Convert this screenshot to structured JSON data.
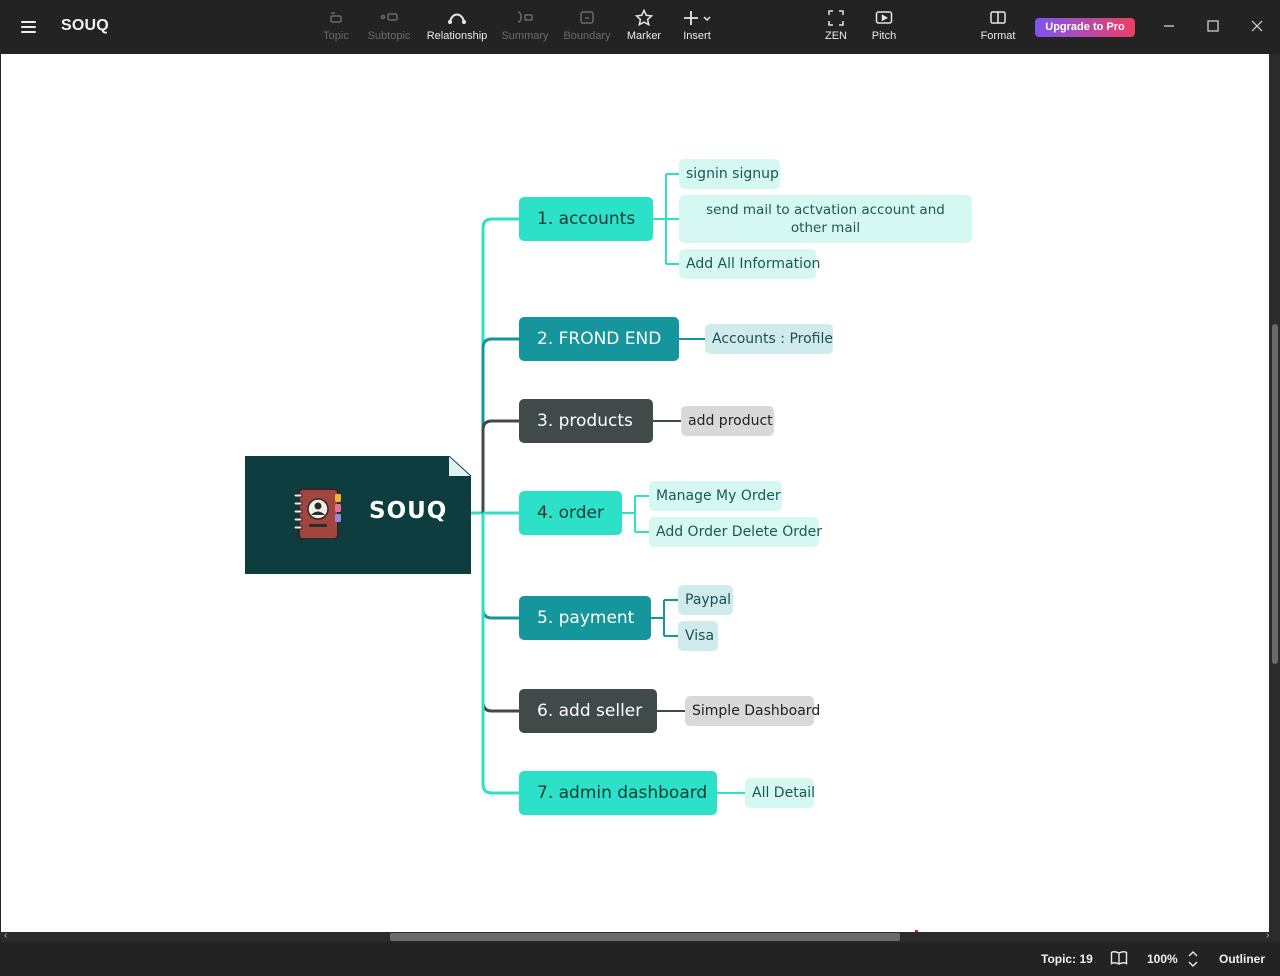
{
  "app": {
    "title": "SOUQ"
  },
  "toolbar": {
    "tools": [
      {
        "label": "Topic",
        "icon": "topic-icon",
        "enabled": false
      },
      {
        "label": "Subtopic",
        "icon": "subtopic-icon",
        "enabled": false
      },
      {
        "label": "Relationship",
        "icon": "relationship-icon",
        "enabled": true
      },
      {
        "label": "Summary",
        "icon": "summary-icon",
        "enabled": false
      },
      {
        "label": "Boundary",
        "icon": "boundary-icon",
        "enabled": false
      },
      {
        "label": "Marker",
        "icon": "star-icon",
        "enabled": true
      },
      {
        "label": "Insert",
        "icon": "plus-icon",
        "enabled": true
      },
      {
        "label": "ZEN",
        "icon": "fullscreen-icon",
        "enabled": true
      },
      {
        "label": "Pitch",
        "icon": "play-icon",
        "enabled": true
      },
      {
        "label": "Format",
        "icon": "panel-icon",
        "enabled": true
      }
    ],
    "upgrade_label": "Upgrade to Pro"
  },
  "mindmap": {
    "root": {
      "label": "SOUQ",
      "icon": "address-book-icon"
    },
    "topics": [
      {
        "label": "1. accounts",
        "style": "light",
        "children": [
          "signin signup",
          "send mail to actvation account and other mail",
          "Add All Information"
        ]
      },
      {
        "label": "2. FROND END",
        "style": "teal",
        "children": [
          "Accounts : Profile"
        ]
      },
      {
        "label": "3. products",
        "style": "dark",
        "children": [
          "add product"
        ]
      },
      {
        "label": "4. order",
        "style": "light",
        "children": [
          "Manage My Order",
          "Add Order Delete Order"
        ]
      },
      {
        "label": "5. payment",
        "style": "teal",
        "children": [
          "Paypal",
          "Visa"
        ]
      },
      {
        "label": "6. add seller",
        "style": "dark",
        "children": [
          "Simple Dashboard"
        ]
      },
      {
        "label": "7. admin dashboard",
        "style": "light",
        "children": [
          "All Detail"
        ]
      }
    ]
  },
  "colors": {
    "root": "#0e3d3f",
    "light_topic": "#2de0c8",
    "teal_topic": "#15959c",
    "dark_topic": "#3f4a49"
  },
  "status": {
    "topic_count": "Topic: 19",
    "zoom": "100%",
    "outliner_label": "Outliner"
  }
}
